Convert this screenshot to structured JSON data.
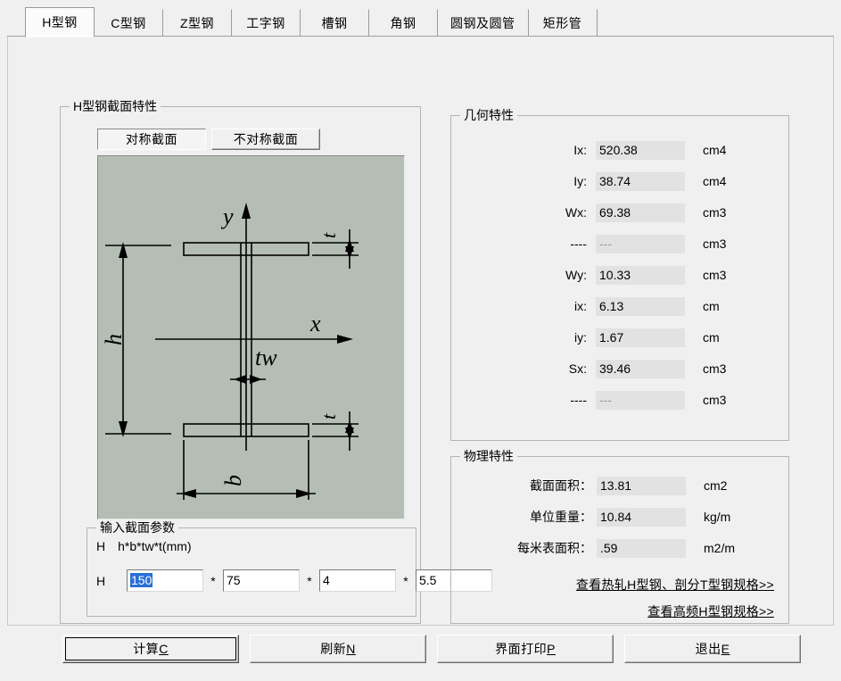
{
  "tabs": [
    {
      "label": "H型钢",
      "selected": true
    },
    {
      "label": "C型钢",
      "selected": false
    },
    {
      "label": "Z型钢",
      "selected": false
    },
    {
      "label": "工字钢",
      "selected": false
    },
    {
      "label": "槽钢",
      "selected": false
    },
    {
      "label": "角钢",
      "selected": false
    },
    {
      "label": "圆钢及圆管",
      "selected": false
    },
    {
      "label": "矩形管",
      "selected": false
    }
  ],
  "section_group": {
    "title": "H型钢截面特性",
    "toggle_symmetric": "对称截面",
    "toggle_asymmetric": "不对称截面",
    "active_toggle": "对称截面"
  },
  "diagram": {
    "label_y": "y",
    "label_x": "x",
    "label_h": "h",
    "label_b": "b",
    "label_tw": "tw",
    "label_t_top": "t",
    "label_t_bottom": "t",
    "background_color": "#b4beb4",
    "line_color": "#000000"
  },
  "geometry": {
    "title": "几何特性",
    "rows": [
      {
        "label": "Ix:",
        "value": "520.38",
        "unit": "cm4",
        "empty": false
      },
      {
        "label": "Iy:",
        "value": "38.74",
        "unit": "cm4",
        "empty": false
      },
      {
        "label": "Wx:",
        "value": "69.38",
        "unit": "cm3",
        "empty": false
      },
      {
        "label": "----",
        "value": "---",
        "unit": "cm3",
        "empty": true
      },
      {
        "label": "Wy:",
        "value": "10.33",
        "unit": "cm3",
        "empty": false
      },
      {
        "label": "ix:",
        "value": "6.13",
        "unit": "cm",
        "empty": false
      },
      {
        "label": "iy:",
        "value": "1.67",
        "unit": "cm",
        "empty": false
      },
      {
        "label": "Sx:",
        "value": "39.46",
        "unit": "cm3",
        "empty": false
      },
      {
        "label": "----",
        "value": "---",
        "unit": "cm3",
        "empty": true
      }
    ]
  },
  "physical": {
    "title": "物理特性",
    "rows": [
      {
        "label": "截面面积：",
        "value": "13.81",
        "unit": "cm2"
      },
      {
        "label": "单位重量：",
        "value": "10.84",
        "unit": "kg/m"
      },
      {
        "label": "每米表面积：",
        "value": ".59",
        "unit": "m2/m"
      }
    ],
    "links": [
      {
        "text": "查看热轧H型钢、剖分T型钢规格>>"
      },
      {
        "text": "查看高频H型钢规格>>"
      }
    ]
  },
  "input": {
    "title": "输入截面参数",
    "header_prefix": "H",
    "header_formula": "h*b*tw*t(mm)",
    "row_prefix": "H",
    "separator": "*",
    "fields": [
      {
        "name": "h",
        "value": "150",
        "selected": true
      },
      {
        "name": "b",
        "value": "75",
        "selected": false
      },
      {
        "name": "tw",
        "value": "4",
        "selected": false
      },
      {
        "name": "t",
        "value": "5.5",
        "selected": false
      }
    ]
  },
  "bottom_buttons": [
    {
      "text": "计算",
      "accel": "C",
      "focused": true
    },
    {
      "text": "刷新",
      "accel": "N",
      "focused": false
    },
    {
      "text": "界面打印",
      "accel": "P",
      "focused": false
    },
    {
      "text": "退出",
      "accel": "E",
      "focused": false
    }
  ]
}
